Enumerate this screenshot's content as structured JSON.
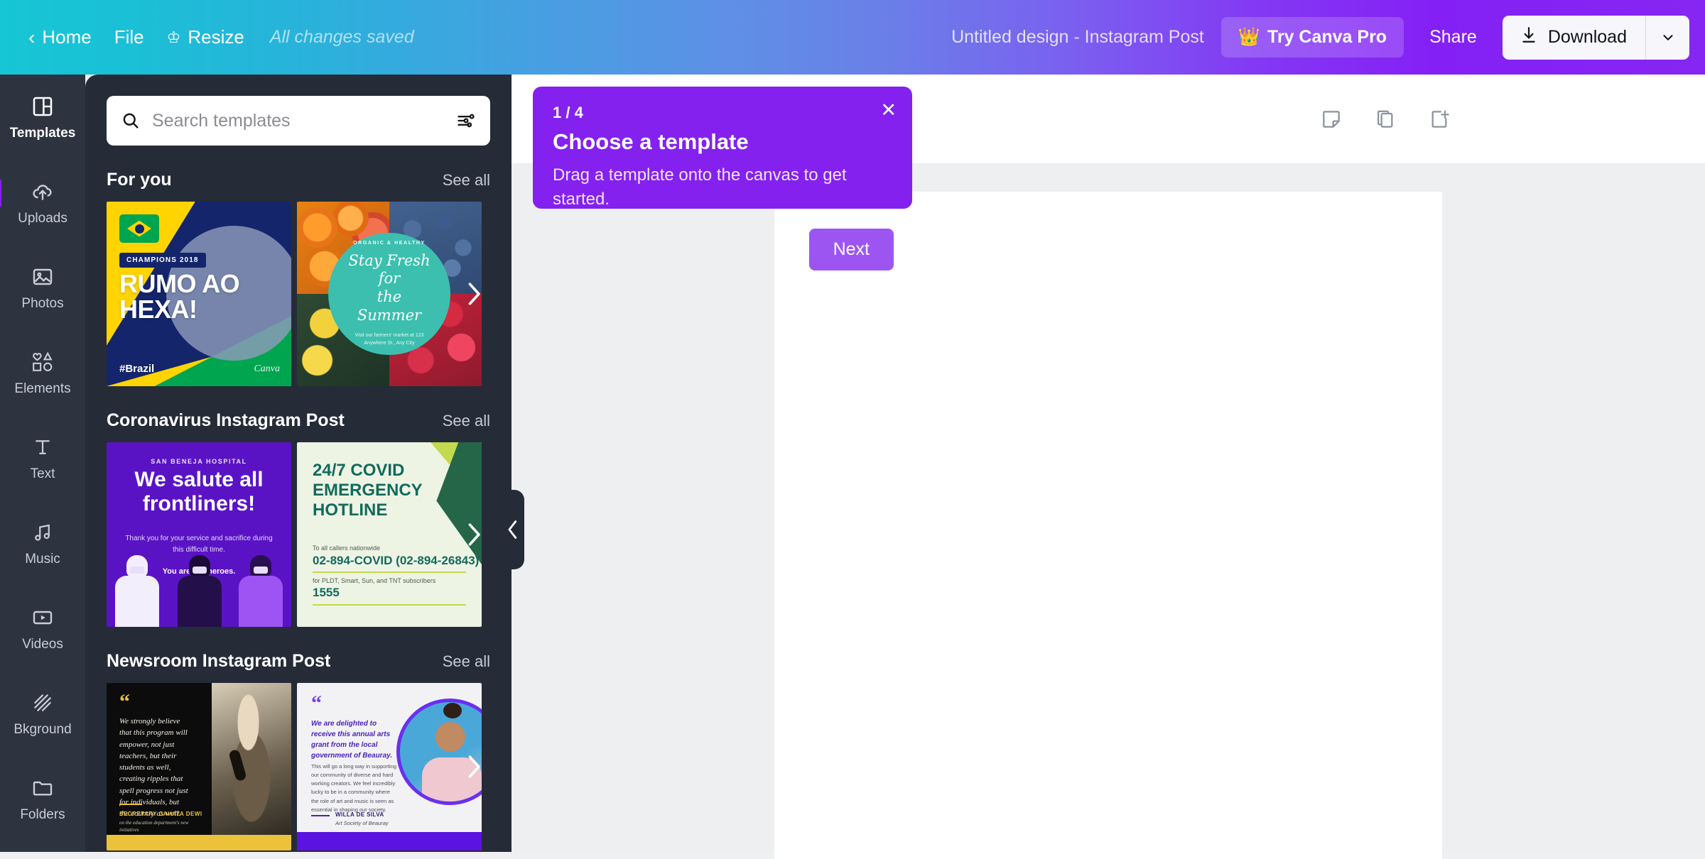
{
  "topbar": {
    "home_label": "Home",
    "back_icon": "chevron-left-icon",
    "file_label": "File",
    "resize_label": "Resize",
    "resize_icon": "crown-icon",
    "saved_status": "All changes saved",
    "doc_title": "Untitled design - Instagram Post",
    "try_pro_label": "Try Canva Pro",
    "try_pro_icon": "crown-icon",
    "share_label": "Share",
    "download_label": "Download",
    "download_icon": "download-icon",
    "download_caret_icon": "chevron-down-icon",
    "gradient_start": "#16c6d4",
    "gradient_end": "#8526f2"
  },
  "rail": {
    "items": [
      {
        "label": "Templates",
        "icon": "templates-icon",
        "active": true
      },
      {
        "label": "Uploads",
        "icon": "cloud-upload-icon",
        "active": false
      },
      {
        "label": "Photos",
        "icon": "image-icon",
        "active": false
      },
      {
        "label": "Elements",
        "icon": "shapes-icon",
        "active": false
      },
      {
        "label": "Text",
        "icon": "text-icon",
        "active": false
      },
      {
        "label": "Music",
        "icon": "music-note-icon",
        "active": false
      },
      {
        "label": "Videos",
        "icon": "video-play-icon",
        "active": false
      },
      {
        "label": "Bkground",
        "icon": "hatch-pattern-icon",
        "active": false
      },
      {
        "label": "Folders",
        "icon": "folder-icon",
        "active": false
      }
    ]
  },
  "panel": {
    "background": "#252c38",
    "search": {
      "placeholder": "Search templates",
      "value": "",
      "search_icon": "search-icon",
      "filter_icon": "sliders-icon"
    },
    "see_all_label": "See all",
    "next_arrow_icon": "chevron-right-icon",
    "collapse_icon": "chevron-left-icon",
    "sections": [
      {
        "title": "For you",
        "see_all": "See all",
        "templates": [
          {
            "name": "brazil-world-cup",
            "flag_label": "",
            "badge": "CHAMPIONS 2018",
            "headline_line1": "RUMO AO",
            "headline_line2": "HEXA!",
            "hashtag": "#Brazil",
            "brand": "Canva"
          },
          {
            "name": "stay-fresh-summer",
            "kicker": "ORGANIC & HEALTHY",
            "script_line1": "Stay Fresh for",
            "script_line2": "the Summer",
            "sub_line1": "Visit our farmers' market at 123",
            "sub_line2": "Anywhere St., Any City"
          }
        ]
      },
      {
        "title": "Coronavirus Instagram Post",
        "see_all": "See all",
        "templates": [
          {
            "name": "salute-frontliners",
            "hospital": "SAN BENEJA HOSPITAL",
            "headline_line1": "We salute all",
            "headline_line2": "frontliners!",
            "body": "Thank you for your service and sacrifice during this difficult time.",
            "closing": "You are our heroes."
          },
          {
            "name": "covid-emergency-hotline",
            "headline_line1": "24/7 COVID",
            "headline_line2": "EMERGENCY",
            "headline_line3": "HOTLINE",
            "label1": "To all callers nationwide",
            "number1": "02-894-COVID (02-894-26843)",
            "label2": "for PLDT, Smart, Sun, and TNT subscribers",
            "number2": "1555"
          }
        ]
      },
      {
        "title": "Newsroom Instagram Post",
        "see_all": "See all",
        "templates": [
          {
            "name": "newsroom-quote-dark",
            "quote_mark": "“",
            "quote": "We strongly believe that this program will empower, not just teachers, but their students as well, creating ripples that spell progress not just for individuals, but the country as well.",
            "attribution": "SECRETARY CAHAYA DEWI",
            "role": "on the education department's new initiatives"
          },
          {
            "name": "newsroom-quote-light",
            "quote_mark": "“",
            "lead": "We are delighted to receive this annual arts grant from the local government of Beauray.",
            "body": "This will go a long way in supporting our community of diverse and hard working creators. We feel incredibly lucky to be in a community where the role of art and music is seen as essential in shaping our society.",
            "attribution": "WILLA DE SILVA",
            "role": "Art Society of Beauray"
          }
        ]
      }
    ]
  },
  "canvas": {
    "toolbar_icons": [
      {
        "name": "notes-icon"
      },
      {
        "name": "duplicate-page-icon"
      },
      {
        "name": "add-page-icon"
      }
    ],
    "page_background": "#ffffff"
  },
  "popup": {
    "step": "1 / 4",
    "title": "Choose a template",
    "body": "Drag a template onto the canvas to get started.",
    "next_label": "Next",
    "close_icon": "close-icon",
    "accent": "#8421ef"
  }
}
